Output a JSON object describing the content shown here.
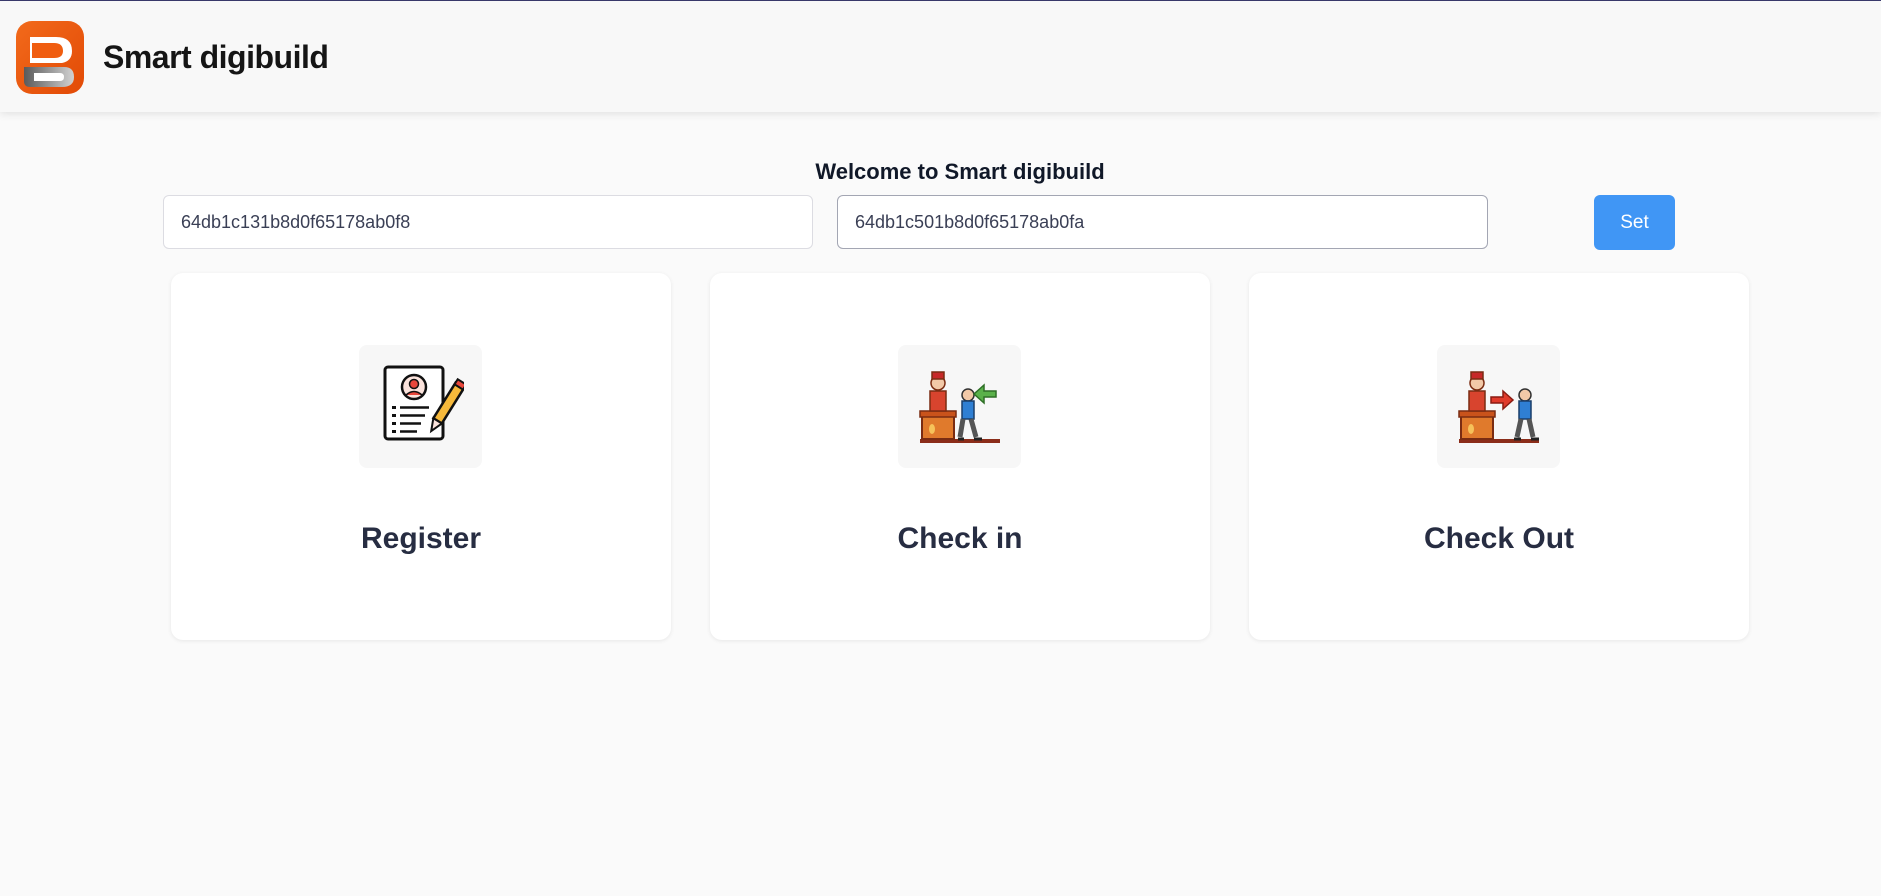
{
  "header": {
    "brand_name": "Smart digibuild",
    "logo_icon": "brand-logo-icon",
    "colors": {
      "logo_orange": "#f0560a",
      "logo_gray": "#8a8a8a"
    }
  },
  "main": {
    "welcome_text": "Welcome to Smart digibuild",
    "input_one": {
      "value": "64db1c131b8d0f65178ab0f8",
      "placeholder": ""
    },
    "input_two": {
      "value": "64db1c501b8d0f65178ab0fa",
      "placeholder": ""
    },
    "set_button_label": "Set",
    "accent_color": "#4096f5"
  },
  "cards": [
    {
      "label": "Register",
      "icon": "register-form-icon"
    },
    {
      "label": "Check in",
      "icon": "check-in-icon"
    },
    {
      "label": "Check Out",
      "icon": "check-out-icon"
    }
  ]
}
